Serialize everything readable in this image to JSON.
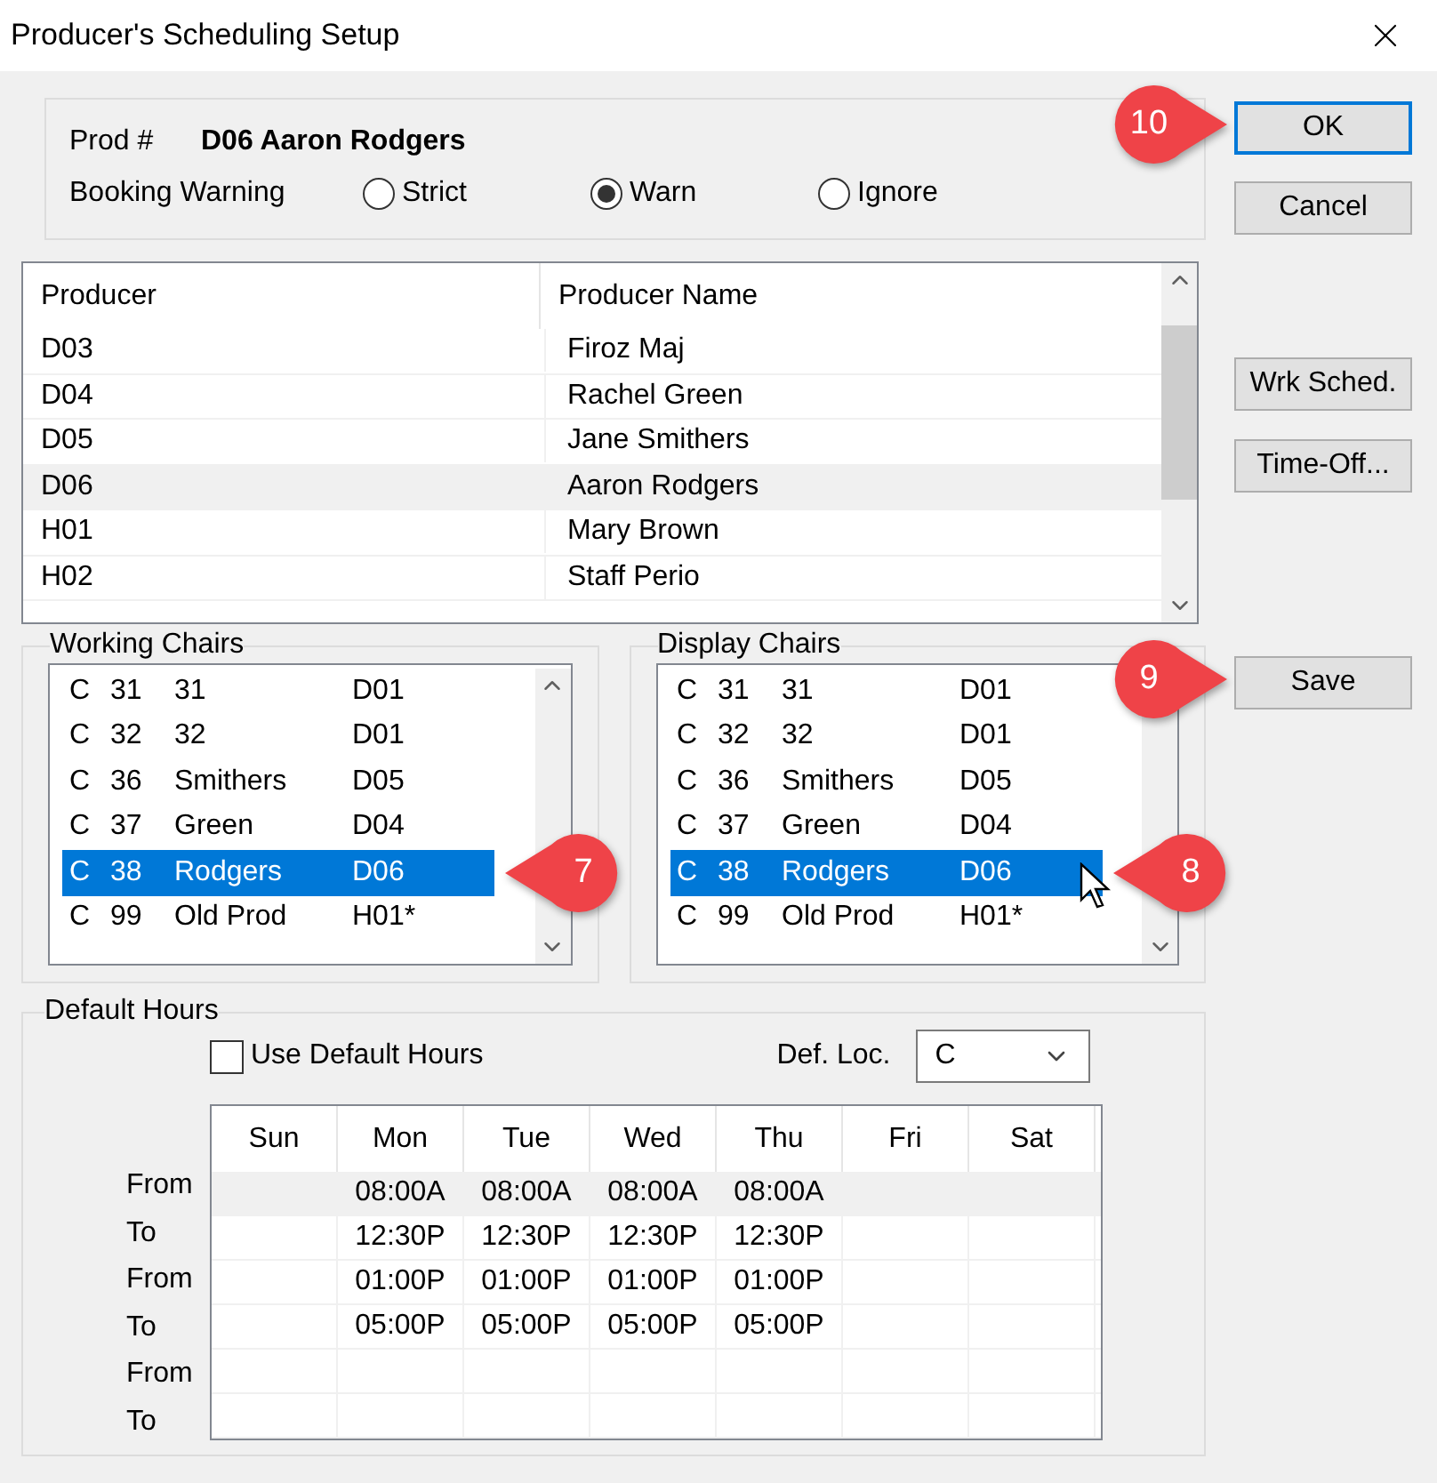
{
  "window": {
    "title": "Producer's Scheduling Setup"
  },
  "header": {
    "prod_label": "Prod #",
    "prod_value": "D06 Aaron Rodgers",
    "booking_label": "Booking Warning",
    "booking_options": [
      {
        "label": "Strict",
        "selected": false
      },
      {
        "label": "Warn",
        "selected": true
      },
      {
        "label": "Ignore",
        "selected": false
      }
    ]
  },
  "buttons_top": [
    {
      "label": "OK",
      "default": true,
      "callout": "10"
    },
    {
      "label": "Cancel",
      "default": false
    }
  ],
  "buttons_middle": [
    {
      "label": "Wrk Sched.",
      "default": false
    },
    {
      "label": "Time-Off...",
      "default": false
    }
  ],
  "save_button": {
    "label": "Save",
    "default": false,
    "callout": "9"
  },
  "producers": {
    "columns": [
      "Producer",
      "Producer Name"
    ],
    "rows": [
      {
        "code": "D03",
        "name": "Firoz Maj",
        "selected": false
      },
      {
        "code": "D04",
        "name": "Rachel Green",
        "selected": false
      },
      {
        "code": "D05",
        "name": "Jane Smithers",
        "selected": false
      },
      {
        "code": "D06",
        "name": "Aaron Rodgers",
        "selected": true
      },
      {
        "code": "H01",
        "name": "Mary Brown",
        "selected": false
      },
      {
        "code": "H02",
        "name": "Staff Perio",
        "selected": false
      }
    ]
  },
  "working_chairs": {
    "title": "Working Chairs",
    "callout": "7",
    "rows": [
      {
        "loc": "C",
        "chair": "31",
        "name": "31",
        "producer": "D01",
        "selected": false
      },
      {
        "loc": "C",
        "chair": "32",
        "name": "32",
        "producer": "D01",
        "selected": false
      },
      {
        "loc": "C",
        "chair": "36",
        "name": "Smithers",
        "producer": "D05",
        "selected": false
      },
      {
        "loc": "C",
        "chair": "37",
        "name": "Green",
        "producer": "D04",
        "selected": false
      },
      {
        "loc": "C",
        "chair": "38",
        "name": "Rodgers",
        "producer": "D06",
        "selected": true
      },
      {
        "loc": "C",
        "chair": "99",
        "name": "Old Prod",
        "producer": "H01*",
        "selected": false
      }
    ]
  },
  "display_chairs": {
    "title": "Display Chairs",
    "callout": "8",
    "rows": [
      {
        "loc": "C",
        "chair": "31",
        "name": "31",
        "producer": "D01",
        "selected": false
      },
      {
        "loc": "C",
        "chair": "32",
        "name": "32",
        "producer": "D01",
        "selected": false
      },
      {
        "loc": "C",
        "chair": "36",
        "name": "Smithers",
        "producer": "D05",
        "selected": false
      },
      {
        "loc": "C",
        "chair": "37",
        "name": "Green",
        "producer": "D04",
        "selected": false
      },
      {
        "loc": "C",
        "chair": "38",
        "name": "Rodgers",
        "producer": "D06",
        "selected": true
      },
      {
        "loc": "C",
        "chair": "99",
        "name": "Old Prod",
        "producer": "H01*",
        "selected": false
      }
    ]
  },
  "default_hours": {
    "title": "Default Hours",
    "use_default": {
      "label": "Use Default Hours",
      "checked": false
    },
    "def_loc": {
      "label": "Def. Loc.",
      "value": "C"
    },
    "days": [
      "Sun",
      "Mon",
      "Tue",
      "Wed",
      "Thu",
      "Fri",
      "Sat"
    ],
    "rows": [
      {
        "label": "From",
        "selected": true,
        "cells": [
          "",
          "08:00A",
          "08:00A",
          "08:00A",
          "08:00A",
          "",
          ""
        ]
      },
      {
        "label": "To",
        "selected": false,
        "cells": [
          "",
          "12:30P",
          "12:30P",
          "12:30P",
          "12:30P",
          "",
          ""
        ]
      },
      {
        "label": "From",
        "selected": false,
        "cells": [
          "",
          "01:00P",
          "01:00P",
          "01:00P",
          "01:00P",
          "",
          ""
        ]
      },
      {
        "label": "To",
        "selected": false,
        "cells": [
          "",
          "05:00P",
          "05:00P",
          "05:00P",
          "05:00P",
          "",
          ""
        ]
      },
      {
        "label": "From",
        "selected": false,
        "cells": [
          "",
          "",
          "",
          "",
          "",
          "",
          ""
        ]
      },
      {
        "label": "To",
        "selected": false,
        "cells": [
          "",
          "",
          "",
          "",
          "",
          "",
          ""
        ]
      }
    ]
  }
}
